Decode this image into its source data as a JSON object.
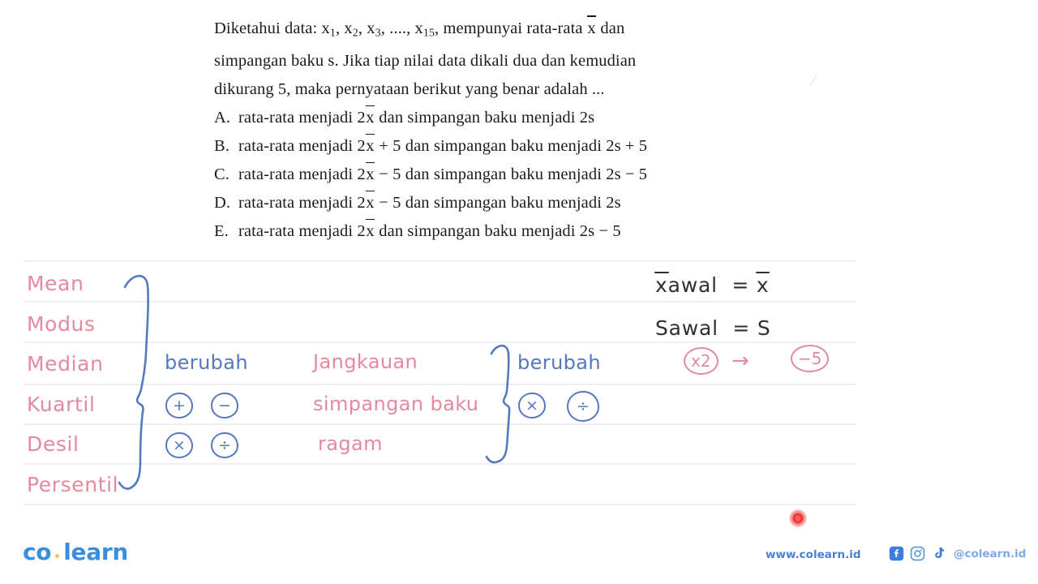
{
  "question": {
    "lines": [
      "Diketahui data: x1, x2, x3, ...., x15, mempunyai rata-rata  x̄ dan",
      "simpangan baku s. Jika tiap nilai data dikali dua dan kemudian",
      "dikurang 5, maka pernyataan berikut yang benar adalah ..."
    ],
    "line1_parts": {
      "pre": "Diketahui data: x",
      "s1": "1",
      "m1": ", x",
      "s2": "2",
      "m2": ", x",
      "s3": "3",
      "m3": ", ...., x",
      "s4": "15",
      "m4": ", mempunyai rata-rata ",
      "xbar": "x",
      "post": " dan"
    },
    "line2": "simpangan baku s. Jika tiap nilai data dikali dua dan kemudian",
    "line3": "dikurang 5, maka pernyataan berikut yang benar adalah ...",
    "options": [
      {
        "letter": "A.",
        "pre": "rata-rata menjadi 2",
        "xbar": "x",
        "post": " dan simpangan baku menjadi 2s"
      },
      {
        "letter": "B.",
        "pre": "rata-rata menjadi 2",
        "xbar": "x",
        "post": " + 5 dan simpangan baku menjadi 2s + 5"
      },
      {
        "letter": "C.",
        "pre": "rata-rata menjadi 2",
        "xbar": "x",
        "post": " − 5 dan simpangan baku menjadi 2s − 5"
      },
      {
        "letter": "D.",
        "pre": "rata-rata menjadi 2",
        "xbar": "x",
        "post": " − 5 dan simpangan baku menjadi 2s"
      },
      {
        "letter": "E.",
        "pre": "rata-rata menjadi 2",
        "xbar": "x",
        "post": " dan simpangan baku menjadi 2s − 5"
      }
    ],
    "stray_mark": "/"
  },
  "annotations": {
    "measures": [
      "Mean",
      "Modus",
      "Median",
      "Kuartil",
      "Desil",
      "Persentil"
    ],
    "spread_terms": [
      "Jangkauan",
      "simpangan baku",
      "ragam"
    ],
    "center_label": "berubah",
    "center_ops": [
      "+",
      "−",
      "×",
      "÷"
    ],
    "spread_label": "berubah",
    "spread_ops": [
      "×",
      "÷"
    ],
    "formulas": [
      {
        "lhs_bar": "x",
        "lhs_rest": "awal",
        "eq": "=",
        "rhs_bar": "x"
      },
      {
        "lhs_bar": "",
        "lhs_rest": "Sawal",
        "eq": "=",
        "rhs_bar": "S"
      }
    ],
    "formula1_text": "x̄awal = x̄",
    "formula2_text": "Sawal = S",
    "transform": {
      "from": "x2",
      "arrow": "→",
      "to": "−5"
    }
  },
  "footer": {
    "logo_left": "co",
    "logo_right": "learn",
    "website": "www.colearn.id",
    "handle": "@colearn.id",
    "social_icons": [
      "facebook-icon",
      "instagram-icon",
      "tiktok-icon"
    ]
  },
  "overlay": {
    "laser_pointer": "red-laser-dot"
  },
  "colors": {
    "pink_ink": "#e4899e",
    "blue_ink": "#5579bd",
    "dark_ink": "#2f3033",
    "rule_line": "#eceef0",
    "brand_blue": "#3b8ede",
    "logo_dot": "#f5c542",
    "laser_red": "#e81414"
  }
}
